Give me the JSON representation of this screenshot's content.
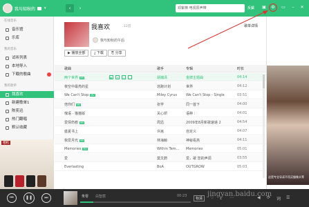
{
  "header": {
    "user_name": "我与知秋的",
    "search_placeholder": "邓紫棋 电视原声带",
    "feedback": "反馈",
    "settings_icon": "gear-icon",
    "accent": "#31c27c"
  },
  "sidebar": {
    "section_online": "在线音乐",
    "online_items": [
      {
        "label": "音乐馆"
      },
      {
        "label": "乐库"
      }
    ],
    "section_mine": "我的音乐",
    "mine_items": [
      {
        "label": "试听列表"
      },
      {
        "label": "本地导入"
      },
      {
        "label": "下载的歌曲"
      }
    ],
    "section_lists": "我的歌单",
    "list_items": [
      {
        "label": "我喜欢"
      },
      {
        "label": "新建歌单1"
      },
      {
        "label": "陈奕迅"
      },
      {
        "label": "热门翻唱"
      },
      {
        "label": "默认收藏"
      }
    ],
    "ad_label": "相机"
  },
  "playlist": {
    "title": "我喜欢",
    "count": "12首",
    "owner": "我与知秋的午后",
    "detail_link": "歌单详情",
    "play_all": "播放全部",
    "download": "下载",
    "share": "分享"
  },
  "table": {
    "headers": {
      "song": "歌曲",
      "artist": "歌手",
      "album": "专辑",
      "duration": "时长"
    },
    "rows": [
      {
        "song": "两个世界",
        "mv": true,
        "artist": "胡瀚泽",
        "album": "金牌主题曲",
        "duration": "04:14"
      },
      {
        "song": "夜空中最亮的星",
        "mv": false,
        "artist": "逃跑计划",
        "album": "世界",
        "duration": "04:12"
      },
      {
        "song": "We Can't Stop",
        "mv": true,
        "artist": "Miley Cyrus",
        "album": "We Can't Stop - Single",
        "duration": "03:51"
      },
      {
        "song": "倍你们",
        "mv": true,
        "artist": "张学",
        "album": "同一首下",
        "duration": "04:00"
      },
      {
        "song": "傀语 - 猫猫版",
        "mv": false,
        "artist": "关心妍",
        "album": "语种 :",
        "duration": "04:01"
      },
      {
        "song": "爱情伤痕",
        "mv": true,
        "artist": "周迅",
        "album": "2009年8月新歌速递 2",
        "duration": "04:54"
      },
      {
        "song": "盛夏书上",
        "mv": false,
        "artist": "许嵩",
        "album": "自定义",
        "duration": "04:07"
      },
      {
        "song": "我爱月光",
        "mv": true,
        "artist": "林海鲸",
        "album": "神秘看高",
        "duration": "04:11"
      },
      {
        "song": "Memories",
        "mv": true,
        "artist": "Within Tem...",
        "album": "Memories",
        "duration": "05:01"
      },
      {
        "song": "爱",
        "mv": false,
        "artist": "莫文蔚",
        "album": "爱，歌 您的声调",
        "duration": "03:55"
      },
      {
        "song": "Everlasting",
        "mv": false,
        "artist": "BoA",
        "album": "OUTGROW",
        "duration": "05:03"
      }
    ]
  },
  "player": {
    "song": "朱零",
    "artist": "白智宸",
    "time": "00:23",
    "quality": "标清",
    "progress": 0.12
  },
  "ad": {
    "caption": "这是专业导读不用买摄像头等"
  },
  "watermark": "jingyan.baidu.com"
}
